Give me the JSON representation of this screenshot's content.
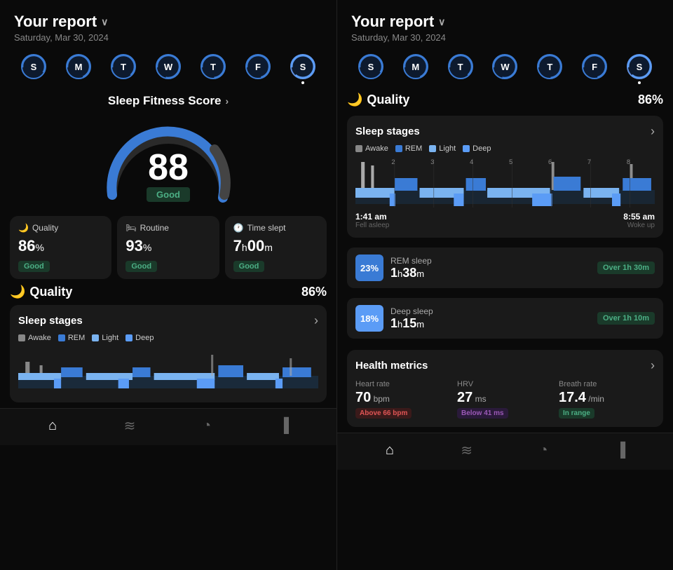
{
  "left": {
    "title": "Your report",
    "date": "Saturday, Mar 30, 2024",
    "days": [
      "S",
      "M",
      "T",
      "W",
      "T",
      "F",
      "S"
    ],
    "active_day_index": 6,
    "score_section_title": "Sleep Fitness Score",
    "score": "88",
    "score_label": "Good",
    "metrics": [
      {
        "icon": "🌙",
        "label": "Quality",
        "value": "86",
        "unit": "%",
        "badge": "Good"
      },
      {
        "icon": "🛏",
        "label": "Routine",
        "value": "93",
        "unit": "%",
        "badge": "Good"
      },
      {
        "icon": "🕐",
        "label": "Time slept",
        "value": "7",
        "value2": "00",
        "unit": "h",
        "unit2": "m",
        "badge": "Good"
      }
    ],
    "quality_title": "Quality",
    "quality_icon": "🌙",
    "quality_pct": "86%",
    "stages_title": "Sleep stages",
    "legend": [
      {
        "color": "#888",
        "label": "Awake"
      },
      {
        "color": "#3a7bd5",
        "label": "REM"
      },
      {
        "color": "#7ab3f0",
        "label": "Light"
      },
      {
        "color": "#5b9cf6",
        "label": "Deep"
      }
    ]
  },
  "right": {
    "title": "Your report",
    "date": "Saturday, Mar 30, 2024",
    "days": [
      "S",
      "M",
      "T",
      "W",
      "T",
      "F",
      "S"
    ],
    "active_day_index": 6,
    "quality_title": "Quality",
    "quality_icon": "🌙",
    "quality_pct": "86%",
    "stages_title": "Sleep stages",
    "legend": [
      {
        "color": "#888",
        "label": "Awake"
      },
      {
        "color": "#3a7bd5",
        "label": "REM"
      },
      {
        "color": "#7ab3f0",
        "label": "Light"
      },
      {
        "color": "#5b9cf6",
        "label": "Deep"
      }
    ],
    "sleep_start_time": "1:41 am",
    "sleep_start_label": "Fell asleep",
    "sleep_end_time": "8:55 am",
    "sleep_end_label": "Woke up",
    "rem_pct": "23%",
    "rem_label": "REM sleep",
    "rem_time_h": "1",
    "rem_time_m": "38",
    "rem_badge": "Over 1h 30m",
    "deep_pct": "18%",
    "deep_label": "Deep sleep",
    "deep_time_h": "1",
    "deep_time_m": "15",
    "deep_badge": "Over 1h 10m",
    "health_title": "Health metrics",
    "metrics": [
      {
        "label": "Heart rate",
        "value": "70",
        "unit": "bpm",
        "badge": "Above 66 bpm",
        "badge_class": "red"
      },
      {
        "label": "HRV",
        "value": "27",
        "unit": "ms",
        "badge": "Below 41 ms",
        "badge_class": "purple"
      },
      {
        "label": "Breath rate",
        "value": "17.4",
        "unit": "/min",
        "badge": "In range",
        "badge_class": "green"
      }
    ]
  },
  "nav": {
    "icons": [
      "home",
      "activity",
      "alarm",
      "chart"
    ]
  }
}
